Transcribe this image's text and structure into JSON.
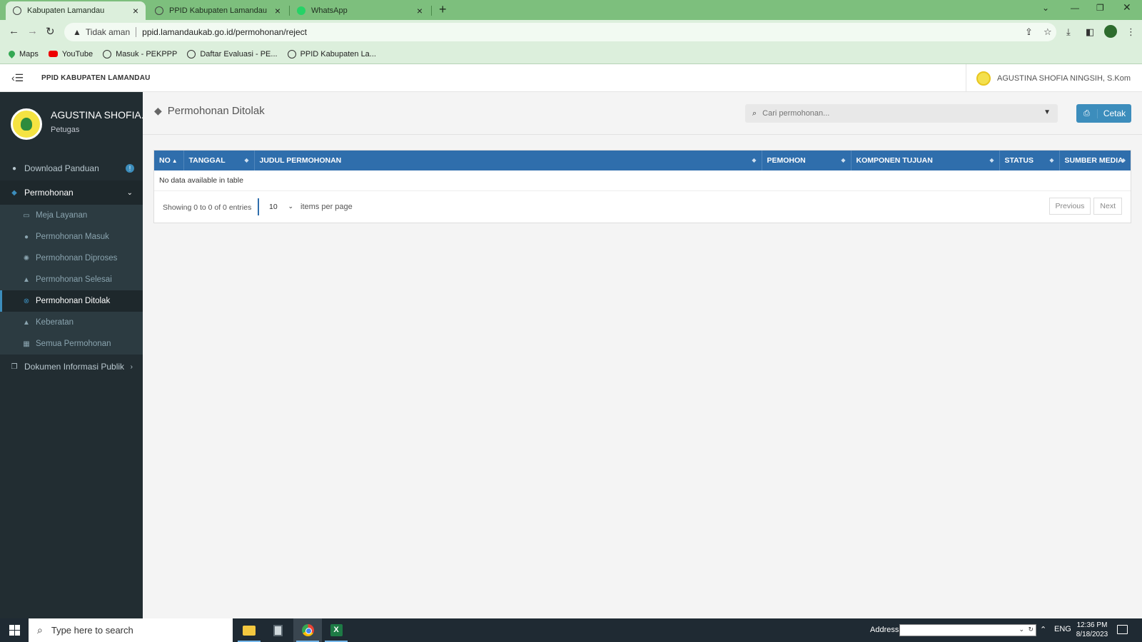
{
  "browser": {
    "tabs": [
      {
        "title": "Kabupaten Lamandau",
        "active": true
      },
      {
        "title": "PPID Kabupaten Lamandau",
        "active": false
      },
      {
        "title": "WhatsApp",
        "active": false
      }
    ],
    "security_label": "Tidak aman",
    "url": "ppid.lamandaukab.go.id/permohonan/reject",
    "bookmarks": [
      {
        "label": "Maps",
        "icon": "maps-pin-icon"
      },
      {
        "label": "YouTube",
        "icon": "youtube-icon"
      },
      {
        "label": "Masuk - PEKPPP",
        "icon": "globe-icon"
      },
      {
        "label": "Daftar Evaluasi - PE...",
        "icon": "globe-icon"
      },
      {
        "label": "PPID Kabupaten La...",
        "icon": "globe-icon"
      }
    ]
  },
  "header": {
    "title": "PPID KABUPATEN LAMANDAU",
    "user_name": "AGUSTINA SHOFIA NINGSIH, S.Kom"
  },
  "sidebar": {
    "profile_name": "AGUSTINA SHOFIA...",
    "profile_role": "Petugas",
    "download_label": "Download Panduan",
    "download_badge": "!",
    "permohonan_label": "Permohonan",
    "sub_items": [
      {
        "label": "Meja Layanan",
        "icon": "desktop-icon"
      },
      {
        "label": "Permohonan Masuk",
        "icon": "comment-icon"
      },
      {
        "label": "Permohonan Diproses",
        "icon": "spinner-icon"
      },
      {
        "label": "Permohonan Selesai",
        "icon": "thumbs-up-icon"
      },
      {
        "label": "Permohonan Ditolak",
        "icon": "times-circle-icon",
        "active": true
      },
      {
        "label": "Keberatan",
        "icon": "warning-icon"
      },
      {
        "label": "Semua Permohonan",
        "icon": "grid-icon"
      }
    ],
    "dokumen_label": "Dokumen Informasi Publik"
  },
  "main": {
    "page_title": "Permohonan Ditolak",
    "search_placeholder": "Cari permohonan...",
    "print_label": "Cetak",
    "table": {
      "columns": [
        "NO",
        "TANGGAL",
        "JUDUL PERMOHONAN",
        "PEMOHON",
        "KOMPONEN TUJUAN",
        "STATUS",
        "SUMBER MEDIA"
      ],
      "empty_message": "No data available in table",
      "showing": "Showing 0 to 0 of 0 entries",
      "per_page_value": "10",
      "per_page_label": "items per page",
      "prev_label": "Previous",
      "next_label": "Next"
    }
  },
  "taskbar": {
    "search_placeholder": "Type here to search",
    "address_label": "Address",
    "language": "ENG",
    "time": "12:36 PM",
    "date": "8/18/2023"
  },
  "colors": {
    "tab_strip": "#7dbf7d",
    "sidebar_bg": "#222d32",
    "table_header": "#2f6eac",
    "accent": "#3c8dbc"
  }
}
